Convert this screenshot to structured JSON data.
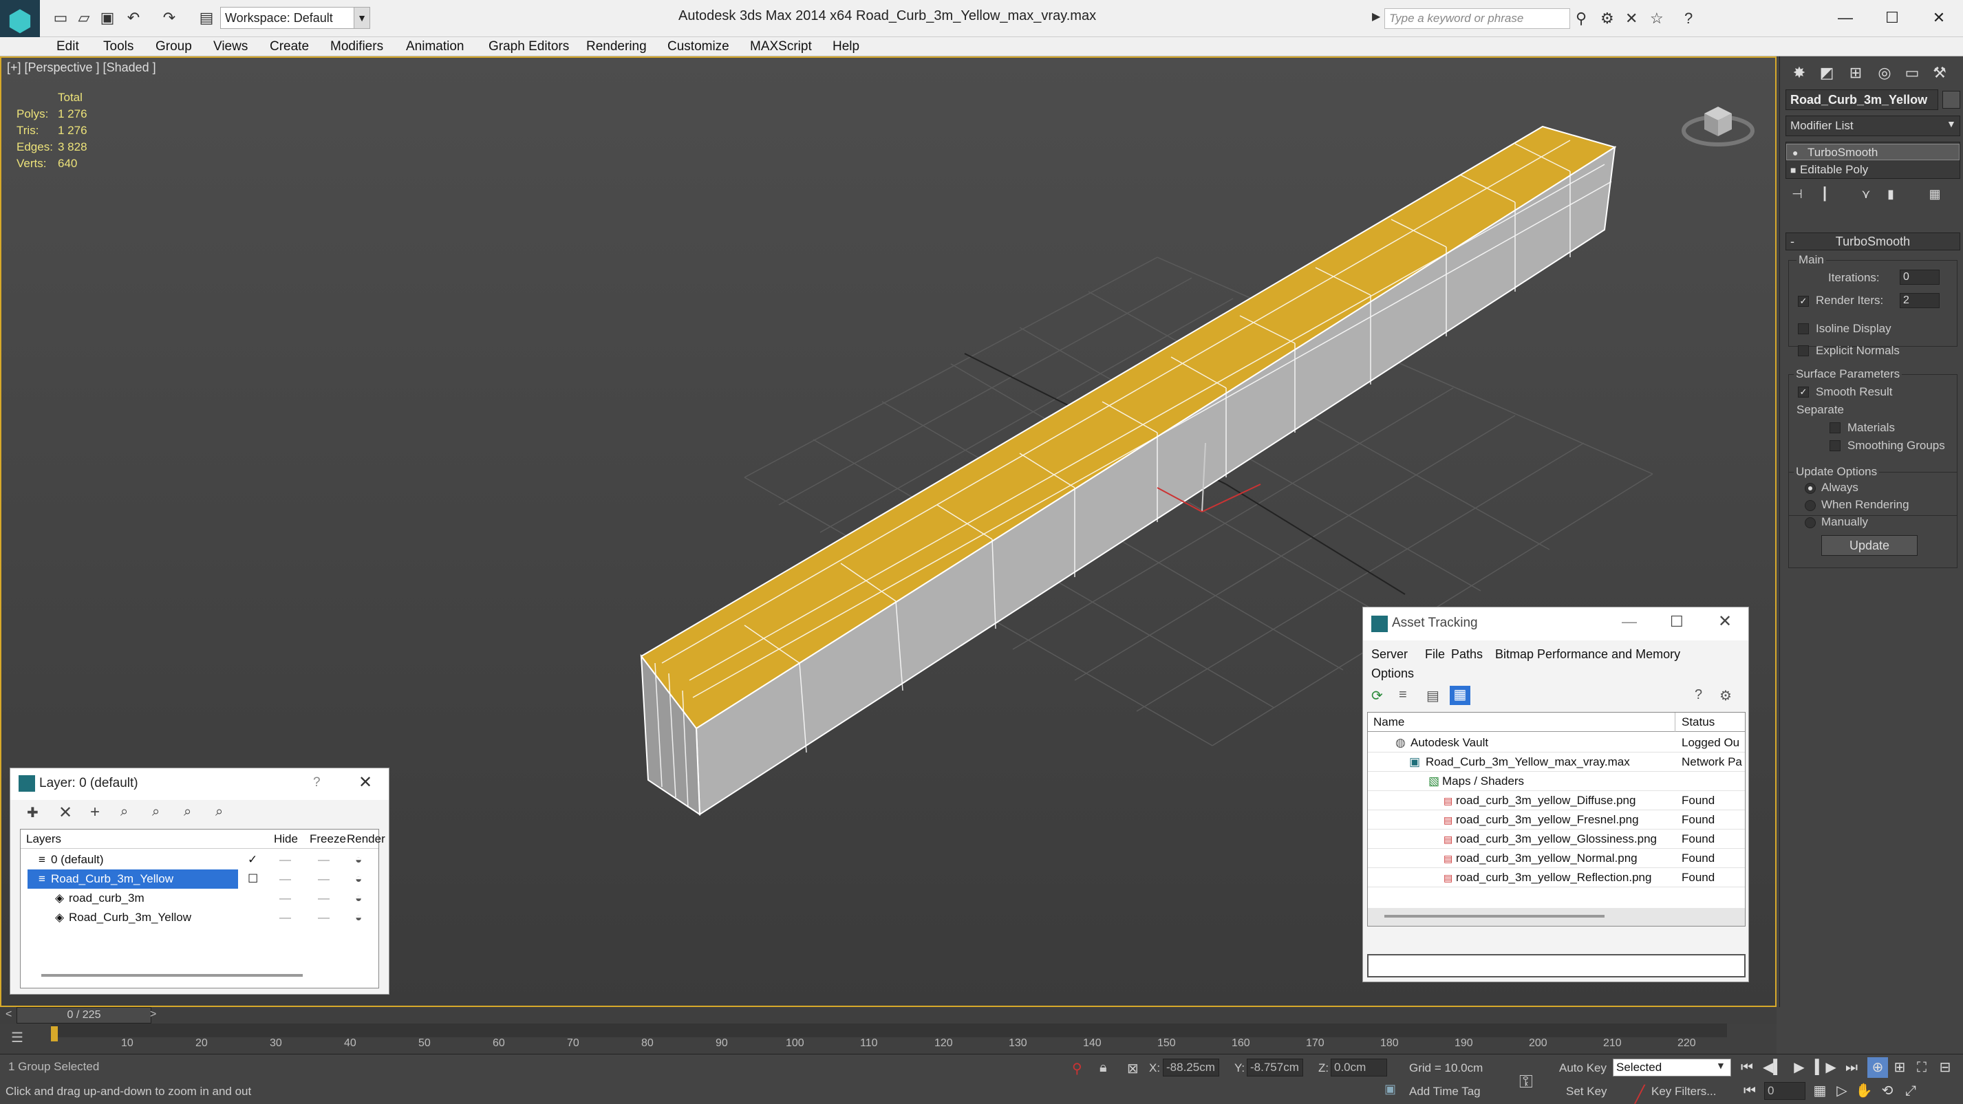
{
  "titlebar": {
    "app_title": "Autodesk 3ds Max  2014 x64",
    "file_title": "Road_Curb_3m_Yellow_max_vray.max",
    "workspace": "Workspace: Default",
    "search_placeholder": "Type a keyword or phrase"
  },
  "menu": [
    "Edit",
    "Tools",
    "Group",
    "Views",
    "Create",
    "Modifiers",
    "Animation",
    "Graph Editors",
    "Rendering",
    "Customize",
    "MAXScript",
    "Help"
  ],
  "viewport": {
    "label": "[+] [Perspective ] [Shaded ]",
    "stats_header": "Total",
    "stats": [
      {
        "label": "Polys:",
        "value": "1 276"
      },
      {
        "label": "Tris:",
        "value": "1 276"
      },
      {
        "label": "Edges:",
        "value": "3 828"
      },
      {
        "label": "Verts:",
        "value": "640"
      }
    ],
    "colors": {
      "yellow": "#d7a92a",
      "border": "#d7a92a"
    }
  },
  "command_panel": {
    "object_name": "Road_Curb_3m_Yellow",
    "modifier_list": "Modifier List",
    "stack": [
      "TurboSmooth",
      "Editable Poly"
    ],
    "rollout_title": "TurboSmooth",
    "main_label": "Main",
    "iterations_label": "Iterations:",
    "iterations_value": "0",
    "render_iters_label": "Render Iters:",
    "render_iters_value": "2",
    "isoline_label": "Isoline Display",
    "explicit_normals_label": "Explicit Normals",
    "surface_params_label": "Surface Parameters",
    "smooth_result_label": "Smooth Result",
    "separate_label": "Separate",
    "materials_label": "Materials",
    "smoothing_groups_label": "Smoothing Groups",
    "update_options_label": "Update Options",
    "always_label": "Always",
    "when_rendering_label": "When Rendering",
    "manually_label": "Manually",
    "update_button": "Update"
  },
  "layer_panel": {
    "title": "Layer: 0 (default)",
    "help": "?",
    "columns": [
      "Layers",
      "Hide",
      "Freeze",
      "Render"
    ],
    "rows": [
      {
        "name": "0 (default)",
        "indent": 1,
        "selected": false
      },
      {
        "name": "Road_Curb_3m_Yellow",
        "indent": 1,
        "selected": true
      },
      {
        "name": "road_curb_3m",
        "indent": 2,
        "selected": false
      },
      {
        "name": "Road_Curb_3m_Yellow",
        "indent": 2,
        "selected": false
      }
    ]
  },
  "asset_tracking": {
    "title": "Asset Tracking",
    "menu": [
      "Server",
      "File",
      "Paths",
      "Bitmap Performance and Memory"
    ],
    "menu2": "Options",
    "columns": [
      "Name",
      "Status"
    ],
    "rows": [
      {
        "name": "Autodesk Vault",
        "status": "Logged Ou",
        "level": 1
      },
      {
        "name": "Road_Curb_3m_Yellow_max_vray.max",
        "status": "Network Pa",
        "level": 2
      },
      {
        "name": "Maps / Shaders",
        "status": "",
        "level": 3
      },
      {
        "name": "road_curb_3m_yellow_Diffuse.png",
        "status": "Found",
        "level": 4
      },
      {
        "name": "road_curb_3m_yellow_Fresnel.png",
        "status": "Found",
        "level": 4
      },
      {
        "name": "road_curb_3m_yellow_Glossiness.png",
        "status": "Found",
        "level": 4
      },
      {
        "name": "road_curb_3m_yellow_Normal.png",
        "status": "Found",
        "level": 4
      },
      {
        "name": "road_curb_3m_yellow_Reflection.png",
        "status": "Found",
        "level": 4
      }
    ]
  },
  "timeline": {
    "frame": "0 / 225",
    "prev": "<",
    "next": ">",
    "ticks": [
      "10",
      "20",
      "30",
      "40",
      "50",
      "60",
      "70",
      "80",
      "90",
      "100",
      "110",
      "120",
      "130",
      "140",
      "150",
      "160",
      "170",
      "180",
      "190",
      "200",
      "210",
      "220"
    ]
  },
  "status": {
    "selection": "1 Group Selected",
    "prompt": "Click and drag up-and-down to zoom in and out",
    "x_label": "X:",
    "x_value": "-88.25cm",
    "y_label": "Y:",
    "y_value": "-8.757cm",
    "z_label": "Z:",
    "z_value": "0.0cm",
    "grid": "Grid = 10.0cm",
    "add_time_tag": "Add Time Tag",
    "auto_key": "Auto Key",
    "set_key": "Set Key",
    "selected_dropdown": "Selected",
    "key_filters": "Key Filters...",
    "frame_field": "0"
  }
}
